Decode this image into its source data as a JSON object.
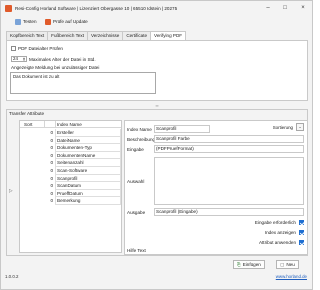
{
  "window": {
    "title": "Resi-Config Horland Software | Lizenziert Obergasse 10 | 65510 Idstein | 20275"
  },
  "toolbar": {
    "test_label": "Testen",
    "check_update_label": "Prüfe auf Update"
  },
  "tabs": [
    {
      "label": "Kopfbereich Text"
    },
    {
      "label": "Fußbereich Text"
    },
    {
      "label": "Verzeichnisse"
    },
    {
      "label": "Certificate"
    },
    {
      "label": "Verifying PDF"
    }
  ],
  "verify": {
    "check_label": "PDF Dateialter Prüfen",
    "check_value": false,
    "max_age_value": "24",
    "max_age_label": "Maximales Alter der Datei in Std.",
    "msg_label": "Angezeigte Meldung bei unzulässiger Datei",
    "msg_value": "Das Dokument ist zu alt"
  },
  "attributes": {
    "section_title": "Transfer Attribute",
    "columns": {
      "sort": "Sort",
      "name": "Index Name"
    },
    "rows": [
      {
        "num": "0",
        "name": "Ersteller"
      },
      {
        "num": "0",
        "name": "DateiName"
      },
      {
        "num": "0",
        "name": "Dokumenten-Typ"
      },
      {
        "num": "0",
        "name": "DokumentenName"
      },
      {
        "num": "0",
        "name": "Seitenanzahl"
      },
      {
        "num": "0",
        "name": "Scan-Software"
      },
      {
        "num": "0",
        "name": "Scanprofil"
      },
      {
        "num": "0",
        "name": "ScanDatum"
      },
      {
        "num": "0",
        "name": "PrueffDatum"
      },
      {
        "num": "0",
        "name": "Bemerkung"
      }
    ]
  },
  "detail": {
    "index_name_label": "Index Name",
    "index_name_value": "Scanprofil",
    "sort_label": "Sortierung",
    "beschreibung_label": "Beschreibung",
    "beschreibung_value": "Scanprofil Farbe",
    "eingabe_label": "Eingabe",
    "eingabe_value": "(PDFPruefFormat)",
    "auswahl_label": "Auswahl",
    "ausgabe_label": "Ausgabe",
    "ausgabe_value": "Scanprofil (Eingabe)",
    "required_label": "Eingabe erforderlich",
    "show_index_label": "Index anzeigen",
    "apply_attr_label": "Attribut anwenden",
    "help_label": "Hilfe Text"
  },
  "buttons": {
    "insert_label": "Einfügen",
    "new_label": "Neu"
  },
  "status": {
    "version": "1.0.0.2",
    "site": "www.horland.de"
  },
  "colors": {
    "accent": "#1f6fd1",
    "brand": "#e05a2a"
  }
}
